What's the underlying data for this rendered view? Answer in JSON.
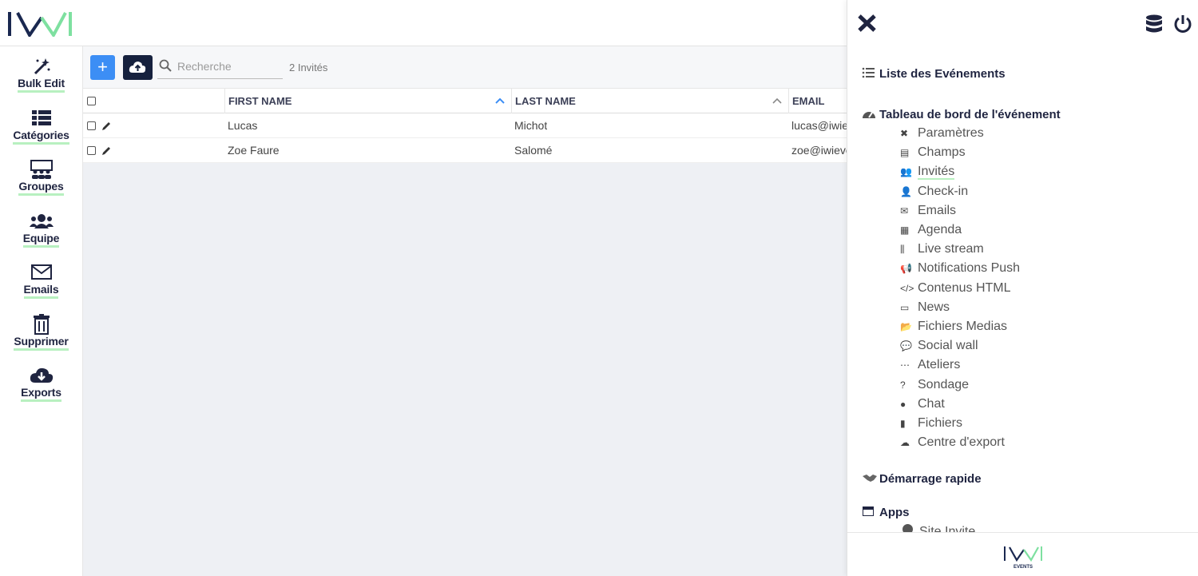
{
  "colors": {
    "accent": "#3c8ef5",
    "dark": "#16213e",
    "underline": "#b8f0c0",
    "logo_dark": "#1a2850",
    "logo_green": "#7ee0a0"
  },
  "sidebar": {
    "items": [
      {
        "label": "Bulk Edit",
        "icon": "magic-wand-icon"
      },
      {
        "label": "Catégories",
        "icon": "list-icon"
      },
      {
        "label": "Groupes",
        "icon": "groups-icon"
      },
      {
        "label": "Equipe",
        "icon": "team-icon"
      },
      {
        "label": "Emails",
        "icon": "envelope-icon"
      },
      {
        "label": "Supprimer",
        "icon": "trash-icon"
      },
      {
        "label": "Exports",
        "icon": "cloud-download-icon"
      }
    ]
  },
  "toolbar": {
    "add_label": "+",
    "search_placeholder": "Recherche",
    "count": "2 Invités"
  },
  "table": {
    "columns": [
      "FIRST NAME",
      "LAST NAME",
      "EMAIL"
    ],
    "rows": [
      {
        "first": "Lucas",
        "last": "Michot",
        "email": "lucas@iwievents.com"
      },
      {
        "first": "Zoe Faure",
        "last": "Salomé",
        "email": "zoe@iwievents.com"
      }
    ]
  },
  "panel": {
    "sections": {
      "events_list": "Liste des Evénements",
      "dashboard": "Tableau de bord de l'événement",
      "quickstart": "Démarrage rapide",
      "apps": "Apps"
    },
    "dashboard_items": [
      {
        "label": "Paramètres",
        "icon": "tools-icon"
      },
      {
        "label": "Champs",
        "icon": "fields-icon"
      },
      {
        "label": "Invités",
        "icon": "guests-icon",
        "active": true
      },
      {
        "label": "Check-in",
        "icon": "user-check-icon"
      },
      {
        "label": "Emails",
        "icon": "envelope-icon"
      },
      {
        "label": "Agenda",
        "icon": "calendar-icon"
      },
      {
        "label": "Live stream",
        "icon": "waveform-icon"
      },
      {
        "label": "Notifications Push",
        "icon": "bullhorn-icon"
      },
      {
        "label": "Contenus HTML",
        "icon": "code-icon"
      },
      {
        "label": "News",
        "icon": "newspaper-icon"
      },
      {
        "label": "Fichiers Medias",
        "icon": "folder-open-icon"
      },
      {
        "label": "Social wall",
        "icon": "comments-icon"
      },
      {
        "label": "Ateliers",
        "icon": "share-nodes-icon"
      },
      {
        "label": "Sondage",
        "icon": "question-circle-icon"
      },
      {
        "label": "Chat",
        "icon": "chat-bubble-icon"
      },
      {
        "label": "Fichiers",
        "icon": "file-icon"
      },
      {
        "label": "Centre d'export",
        "icon": "cloud-download-icon"
      }
    ],
    "apps_items": [
      {
        "label": "Site Invite",
        "icon": "globe-icon"
      }
    ],
    "footer_logo_text": "EVENTS"
  }
}
